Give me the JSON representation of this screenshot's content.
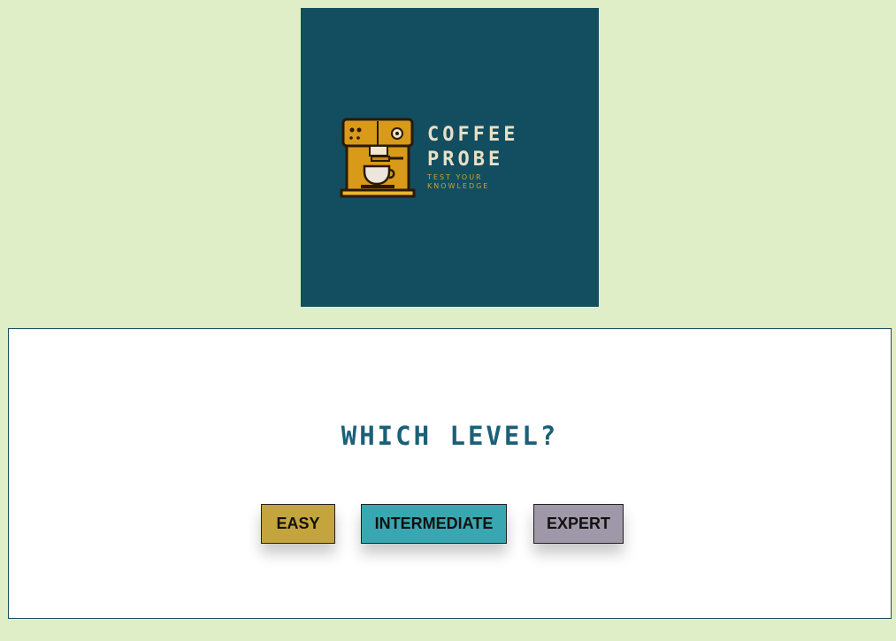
{
  "logo": {
    "line1": "COFFEE",
    "line2": "PROBE",
    "tagline": "TEST YOUR KNOWLEDGE",
    "icon": "coffee-machine-icon",
    "background": "#124e5f",
    "accent": "#d59c18"
  },
  "quiz": {
    "question": "WHICH LEVEL?",
    "buttons": {
      "easy": "EASY",
      "intermediate": "INTERMEDIATE",
      "expert": "EXPERT"
    }
  },
  "colors": {
    "page_background": "#dfeec6",
    "question_text": "#1b5f78",
    "easy": "#c4a43d",
    "intermediate": "#39a7b1",
    "expert": "#9f98a8"
  }
}
